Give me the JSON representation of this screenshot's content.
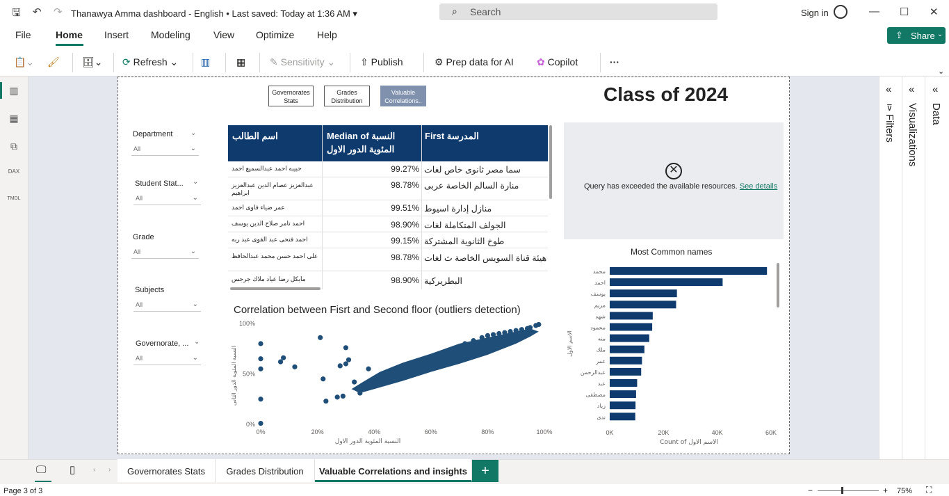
{
  "titlebar": {
    "title": "Thanawya Amma dashboard - English",
    "saved": "Last saved: Today at 1:36 AM",
    "search_placeholder": "Search",
    "signin": "Sign in"
  },
  "menu": [
    "File",
    "Home",
    "Insert",
    "Modeling",
    "View",
    "Optimize",
    "Help"
  ],
  "share_label": "Share",
  "toolbar": {
    "refresh": "Refresh",
    "sensitivity": "Sensitivity",
    "publish": "Publish",
    "prep": "Prep data for AI",
    "copilot": "Copilot",
    "more": "···"
  },
  "slicers": [
    {
      "title": "Department",
      "value": "All"
    },
    {
      "title": "Student Stat...",
      "value": "All"
    },
    {
      "title": "Grade",
      "value": "All"
    },
    {
      "title": "Subjects",
      "value": "All"
    },
    {
      "title": "Governorate, ...",
      "value": "All"
    }
  ],
  "nav_buttons": [
    "Governorates Stats",
    "Grades Distribution",
    "Valuable Correlations.."
  ],
  "report_title": "Class of 2024",
  "table": {
    "headers": [
      "اسم الطالب",
      "Median of النسبة المئوية الدور الاول",
      "First المدرسة"
    ],
    "rows": [
      [
        "حبيبه احمد عبدالسميع احمد",
        "99.27%",
        "سما مصر ثانوى خاص لغات"
      ],
      [
        "عبدالعزيز عصام الدين عبدالعزيز ابراهيم",
        "98.78%",
        "منارة السالم الخاصة عربى"
      ],
      [
        "عمر ضياء فاوى احمد",
        "99.51%",
        "منازل إدارة اسيوط"
      ],
      [
        "احمد تامر صلاح الدين يوسف",
        "98.90%",
        "الجولف المتكاملة لغات"
      ],
      [
        "احمد فتحى عبد القوى عبد ربه",
        "99.15%",
        "طوخ الثانوية المشتركة"
      ],
      [
        "على احمد حسن محمد عبدالحافظ",
        "98.78%",
        "هيئة قناة السويس الخاصة ث لغات"
      ],
      [
        "مايكل رضا عياد ملاك جرجس",
        "98.90%",
        "البطريركية"
      ]
    ]
  },
  "error": {
    "message": "Query has exceeded the available resources.",
    "link": "See details"
  },
  "chart_data": [
    {
      "type": "scatter",
      "title": "Correlation between Fisrt and Second floor (outliers detection)",
      "xlabel": "النسبة المئوية الدور الاول",
      "ylabel": "النسبة المئوية الدور الثانى",
      "xlim": [
        0,
        100
      ],
      "ylim": [
        0,
        100
      ],
      "x_ticks": [
        "0%",
        "20%",
        "40%",
        "60%",
        "80%",
        "100%"
      ],
      "y_ticks": [
        "0%",
        "50%",
        "100%"
      ],
      "points": [
        [
          0,
          80
        ],
        [
          0,
          65
        ],
        [
          0,
          55
        ],
        [
          0,
          25
        ],
        [
          0,
          1
        ],
        [
          7,
          62
        ],
        [
          8,
          66
        ],
        [
          12,
          57
        ],
        [
          21,
          86
        ],
        [
          22,
          45
        ],
        [
          23,
          23
        ],
        [
          27,
          27
        ],
        [
          28,
          58
        ],
        [
          29,
          28
        ],
        [
          30,
          60
        ],
        [
          30,
          76
        ],
        [
          31,
          64
        ],
        [
          33,
          42
        ],
        [
          34,
          35
        ],
        [
          35,
          31
        ],
        [
          36,
          38
        ],
        [
          37,
          39
        ],
        [
          38,
          55
        ],
        [
          40,
          43
        ],
        [
          42,
          46
        ],
        [
          45,
          47
        ],
        [
          48,
          50
        ],
        [
          50,
          52
        ],
        [
          52,
          56
        ],
        [
          55,
          58
        ],
        [
          58,
          60
        ],
        [
          60,
          65
        ],
        [
          62,
          67
        ],
        [
          65,
          70
        ],
        [
          68,
          74
        ],
        [
          70,
          76
        ],
        [
          72,
          80
        ],
        [
          75,
          83
        ],
        [
          78,
          86
        ],
        [
          80,
          88
        ],
        [
          82,
          89
        ],
        [
          84,
          90
        ],
        [
          86,
          91
        ],
        [
          88,
          92
        ],
        [
          90,
          93
        ],
        [
          92,
          94
        ],
        [
          94,
          95
        ],
        [
          95,
          96
        ],
        [
          97,
          98
        ],
        [
          98,
          99
        ]
      ]
    },
    {
      "type": "bar",
      "title": "Most Common names",
      "xlabel": "Count of الاسم الاول",
      "ylabel": "الاسم الاول",
      "xlim": [
        0,
        60000
      ],
      "x_ticks": [
        "0K",
        "20K",
        "40K",
        "60K"
      ],
      "categories": [
        "محمد",
        "احمد",
        "يوسف",
        "مريم",
        "شهد",
        "محمود",
        "منه",
        "ملك",
        "عمر",
        "عبدالرحمن",
        "عبد",
        "مصطفى",
        "زياد",
        "ندى"
      ],
      "values": [
        58500,
        42000,
        25000,
        24700,
        16000,
        15800,
        14700,
        12900,
        12000,
        11700,
        10200,
        9800,
        9600,
        9500
      ]
    }
  ],
  "pages": [
    "Governorates Stats",
    "Grades Distribution",
    "Valuable Correlations and insights"
  ],
  "status": {
    "page": "Page 3 of 3",
    "zoom": "75%"
  },
  "panes": {
    "filters": "Filters",
    "visualizations": "Visualizations",
    "data": "Data"
  },
  "colors": {
    "accent": "#117865",
    "navy": "#0e3a6e",
    "scatter": "#1f4e79"
  }
}
